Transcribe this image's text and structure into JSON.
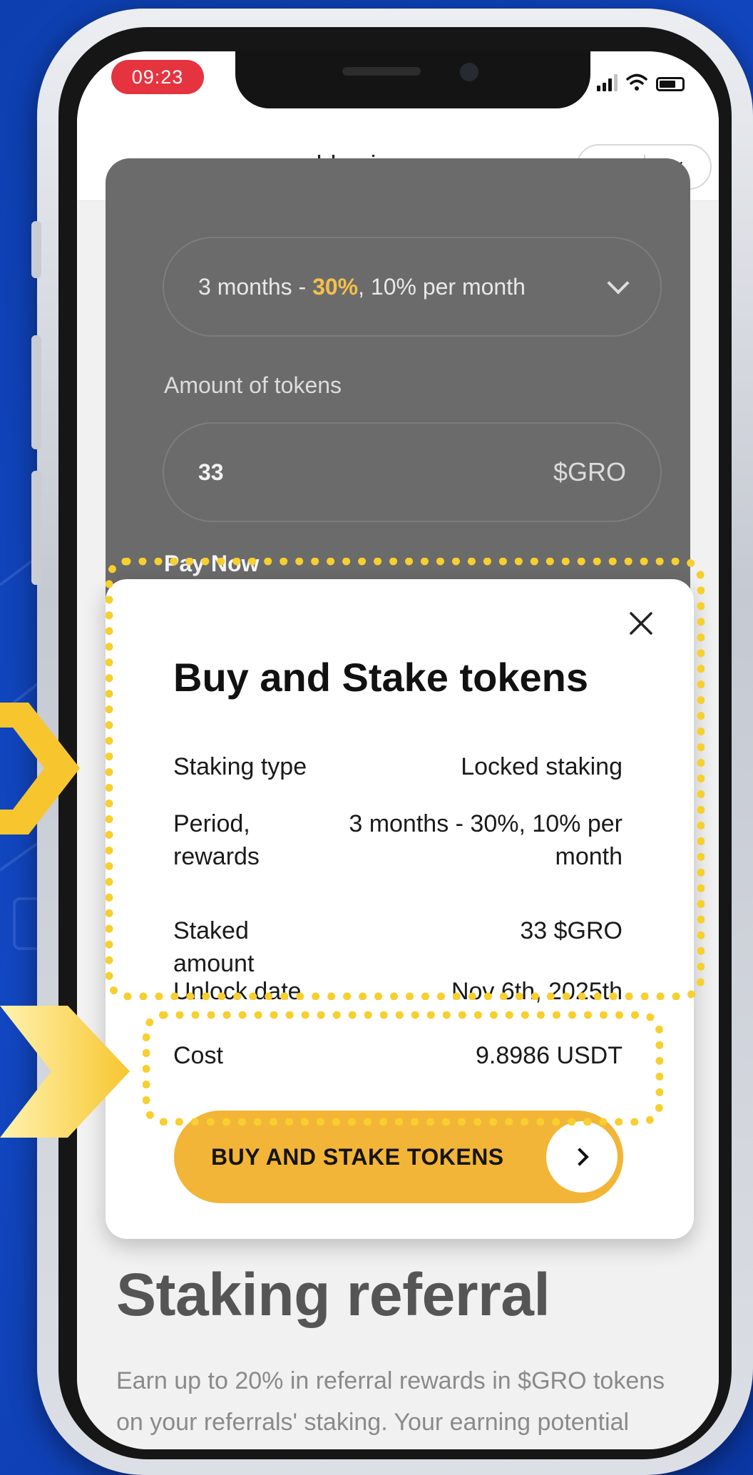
{
  "status_bar": {
    "time": "09:23"
  },
  "browser": {
    "url": "groworld.asia",
    "more_label": "···",
    "close_label": "×"
  },
  "form": {
    "period": {
      "prefix": "3 months - ",
      "highlight": "30%",
      "suffix": ", 10% per month"
    },
    "amount_label": "Amount of tokens",
    "amount_value": "33",
    "amount_unit": "$GRO",
    "pay_now_label": "Pay Now"
  },
  "modal": {
    "title": "Buy and Stake tokens",
    "rows": [
      {
        "label": "Staking type",
        "value": "Locked staking"
      },
      {
        "label": "Period, rewards",
        "value": "3 months - 30%, 10% per month"
      },
      {
        "label": "Staked amount",
        "value": "33 $GRO"
      },
      {
        "label": "Unlock date",
        "value": "Nov 6th, 2025th"
      },
      {
        "label": "Cost",
        "value": "9.8986 USDT"
      }
    ],
    "buy_button_label": "BUY AND STAKE TOKENS"
  },
  "section": {
    "title": "Staking referral",
    "description": "Earn up to 20% in referral rewards in $GRO tokens on your referrals' staking. Your earning potential grows with your referral"
  },
  "colors": {
    "accent_yellow": "#f3b537",
    "highlight_dots": "#f7cf2e",
    "background_blue": "#1247c2",
    "dark_panel": "#6b6b6b"
  }
}
